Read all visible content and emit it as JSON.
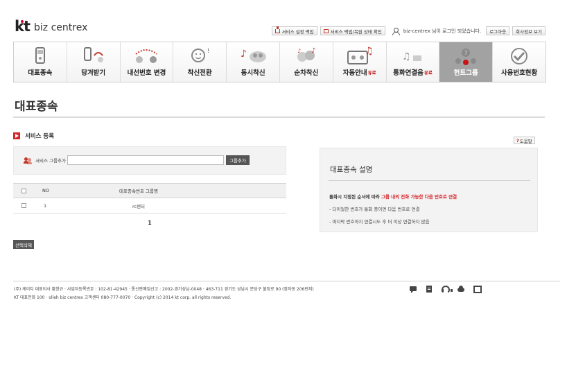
{
  "header": {
    "logo_mark": "kt",
    "logo_text": "biz centrex",
    "service_backup_label": "서비스 설정 백업",
    "service_restore_label": "서비스 백업/복원 상태 확인",
    "login_status": "biz-centrex 님이 로그인 되었습니다.",
    "logout_label": "로그아웃",
    "company_info_label": "회사정보 보기"
  },
  "nav": {
    "items": [
      {
        "label": "대표종속",
        "badge": "",
        "icon": "phone-icon"
      },
      {
        "label": "당겨받기",
        "badge": "",
        "icon": "pickup-icon"
      },
      {
        "label": "내선번호 변경",
        "badge": "",
        "icon": "extension-icon"
      },
      {
        "label": "착신전환",
        "badge": "",
        "icon": "forward-icon"
      },
      {
        "label": "동시착신",
        "badge": "",
        "icon": "simultaneous-icon"
      },
      {
        "label": "순차착신",
        "badge": "",
        "icon": "sequential-icon"
      },
      {
        "label": "자동안내",
        "badge": "유료",
        "icon": "auto-guide-icon"
      },
      {
        "label": "통화연결음",
        "badge": "유료",
        "icon": "ringback-icon"
      },
      {
        "label": "헌트그룹",
        "badge": "",
        "icon": "hunt-group-icon"
      },
      {
        "label": "사용번호현황",
        "badge": "",
        "icon": "usage-status-icon"
      }
    ],
    "active_index": 8
  },
  "page": {
    "title": "대표종속",
    "section_title": "서비스 등록",
    "help_label": "도움말"
  },
  "group_form": {
    "label": "서비스 그룹추가",
    "input_value": "",
    "add_button": "그룹추가"
  },
  "table": {
    "columns": [
      "NO",
      "대표종속번호 그룹명"
    ],
    "rows": [
      {
        "no": "1",
        "name": "rc센터"
      }
    ],
    "page_number": "1",
    "delete_button": "선택삭제"
  },
  "description": {
    "title": "대표종속 설명",
    "main_prefix": "통화시 지정된 순서에 따라 ",
    "main_highlight": "그룹 내의 전화 가능한 다음 번호로 연결",
    "line1": "- 다이얼한 번호가 통화 중이면 다음 번호로 연결",
    "line2": "- 마지막 번호까지 연결시도 후 더 이상 연결하지 않음"
  },
  "footer": {
    "line1": "(주) 케이티 대표이사 황창규 · 사업자등록번호 : 102-81-42945 · 통신판매업신고 : 2002-경기성남-0048 · 463-711 경기도 성남시 분당구 불정로 90 (정자동 206번지)",
    "line2": "KT 대표전화 100 · olleh biz centrex 고객센터 080-777-0070 · Copyright (c) 2014 kt corp. all rights reserved.",
    "icons": [
      "chat-icon",
      "memo-icon",
      "headset-icon",
      "cloud-icon",
      "monitor-icon"
    ]
  },
  "colors": {
    "accent": "#d4262c",
    "active_tab": "#a2a2a2",
    "button_dark": "#555555"
  }
}
